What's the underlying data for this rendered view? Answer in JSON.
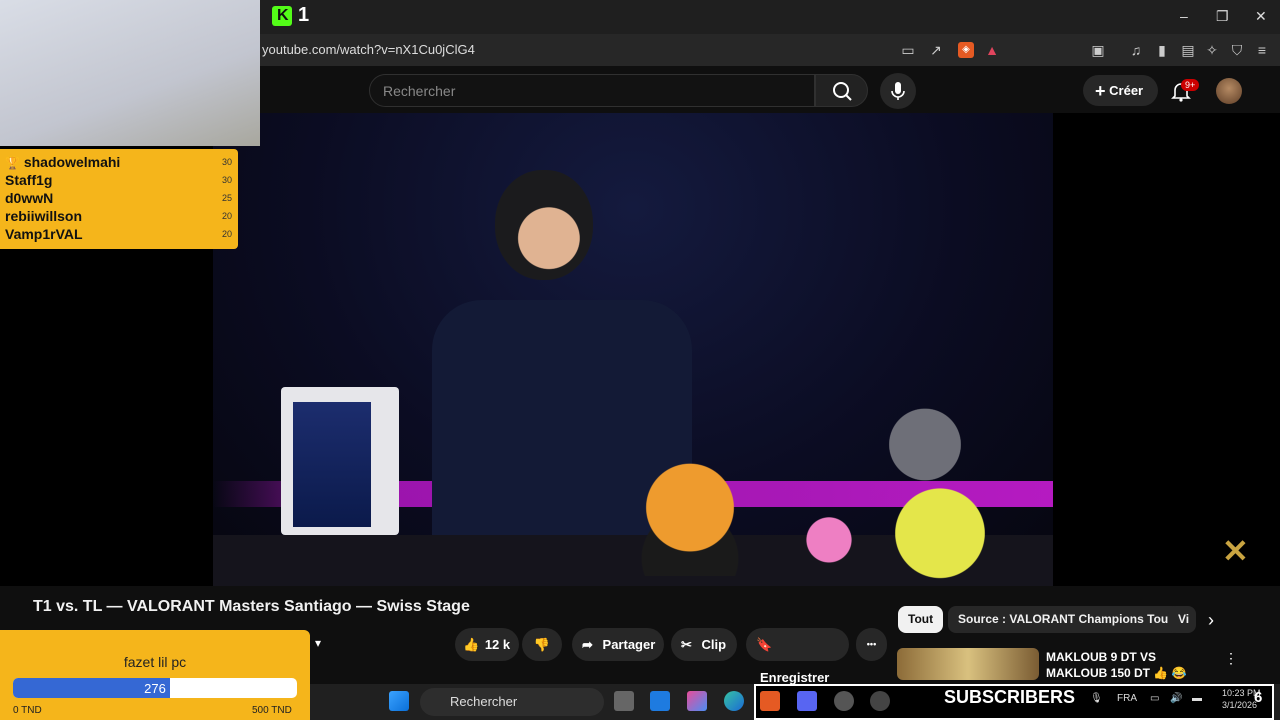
{
  "browser": {
    "tab_title": "1",
    "url": "youtube.com/watch?v=nX1Cu0jClG4",
    "window_controls": {
      "minimize": "–",
      "maximize": "❐",
      "close": "✕"
    }
  },
  "youtube": {
    "search_placeholder": "Rechercher",
    "create_label": "Créer",
    "notification_badge": "9+"
  },
  "video": {
    "title": "T1 vs. TL — VALORANT Masters Santiago — Swiss Stage",
    "like_count": "12 k",
    "share_label": "Partager",
    "clip_label": "Clip",
    "save_label": "Enregistrer",
    "more_label": "•••",
    "overlay_logo": "✕"
  },
  "chips": {
    "all": "Tout",
    "source": "Source : VALORANT Champions Tour",
    "partial": "Vi"
  },
  "recommendation": {
    "title": "MAKLOUB 9 DT VS MAKLOUB 150 DT 👍 😂"
  },
  "leaderboard": [
    {
      "name": "shadowelmahi",
      "score": "30",
      "icon": "trophy-icon"
    },
    {
      "name": "Staff1g",
      "score": "30"
    },
    {
      "name": "d0wwN",
      "score": "25"
    },
    {
      "name": "rebiiwillson",
      "score": "20"
    },
    {
      "name": "Vamp1rVAL",
      "score": "20"
    }
  ],
  "donation_goal": {
    "name": "fazet lil pc",
    "current": "276",
    "progress": 0.552,
    "min_label": "0 TND",
    "max_label": "500 TND"
  },
  "taskbar": {
    "search_label": "Rechercher",
    "subscribers_label": "SUBSCRIBERS",
    "language": "FRA",
    "time": "10:23 PM",
    "date": "3/1/2026",
    "counter": "6"
  },
  "colors": {
    "overlay_accent": "#f5b51b",
    "goal_fill": "#3568d4",
    "yt_red": "#cc0000"
  }
}
